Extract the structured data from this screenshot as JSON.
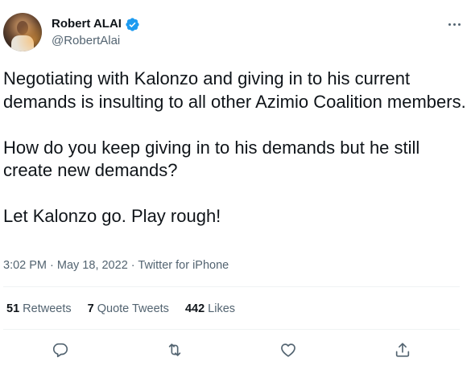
{
  "author": {
    "display_name": "Robert ALAI",
    "handle": "@RobertAlai",
    "verified": true
  },
  "tweet": {
    "text": "Negotiating with Kalonzo and giving in to his current demands is insulting to all other Azimio Coalition members.\n\nHow do you keep giving in to his demands but he still create new demands?\n\nLet Kalonzo go. Play rough!",
    "time": "3:02 PM",
    "date": "May 18, 2022",
    "source": "Twitter for iPhone"
  },
  "stats": {
    "retweets_count": "51",
    "retweets_label": "Retweets",
    "quotes_count": "7",
    "quotes_label": "Quote Tweets",
    "likes_count": "442",
    "likes_label": "Likes"
  },
  "actions": [
    {
      "icon": "reply-icon"
    },
    {
      "icon": "retweet-icon"
    },
    {
      "icon": "like-icon"
    },
    {
      "icon": "share-icon"
    }
  ],
  "colors": {
    "text": "#0f1419",
    "secondary": "#536471",
    "verified_badge": "#1d9bf0",
    "divider": "#eff3f4"
  }
}
